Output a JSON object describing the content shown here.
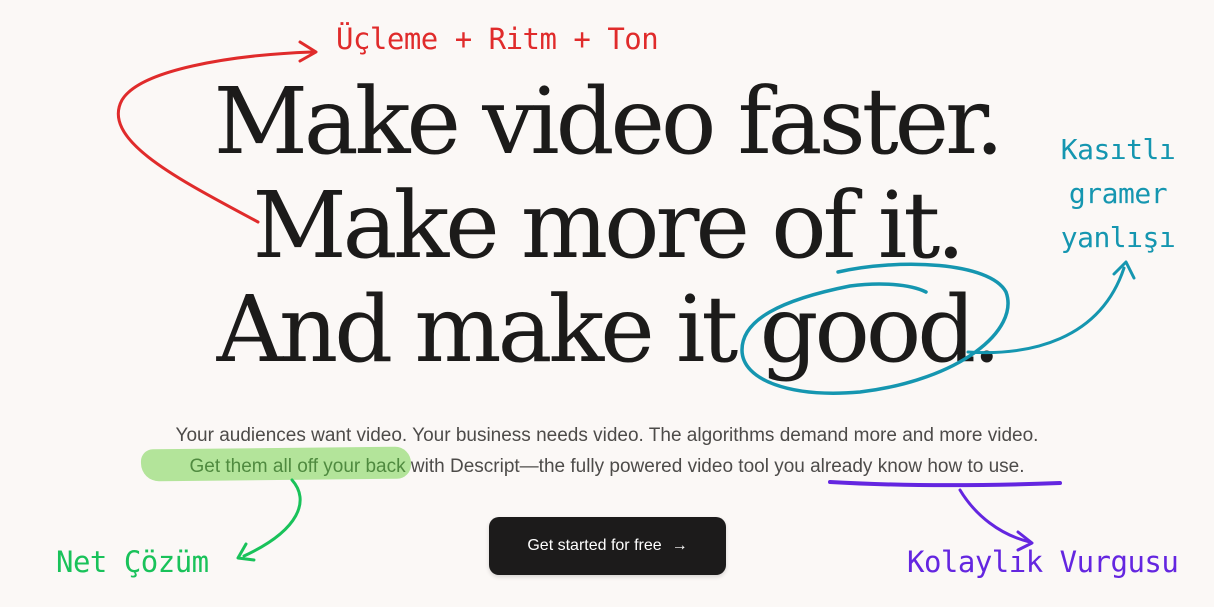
{
  "headline": {
    "line1": "Make video faster.",
    "line2": "Make more of it.",
    "line3": "And make it good."
  },
  "subtext": {
    "line1": "Your audiences want video. Your business needs video. The algorithms demand more and more video.",
    "line2_highlight": "Get them all off your back",
    "line2_rest": " with Descript—the fully powered video tool you already know how to use."
  },
  "cta": {
    "label": "Get started for free",
    "icon": "arrow-right-icon"
  },
  "annotations": {
    "red": {
      "text": "Üçleme + Ritm + Ton",
      "color": "#e02b2b"
    },
    "teal": {
      "line1": "Kasıtlı",
      "line2": "gramer",
      "line3": "yanlışı",
      "color": "#1596b0"
    },
    "green": {
      "text": "Net Çözüm",
      "color": "#19c25a"
    },
    "purple": {
      "text": "Kolaylık Vurgusu",
      "color": "#6426e0"
    }
  },
  "colors": {
    "background": "#fbf8f6",
    "headline": "#1c1b1a",
    "body_text": "#4d4b49",
    "button_bg": "#1c1b1b",
    "highlight_green": "#a6e089"
  }
}
